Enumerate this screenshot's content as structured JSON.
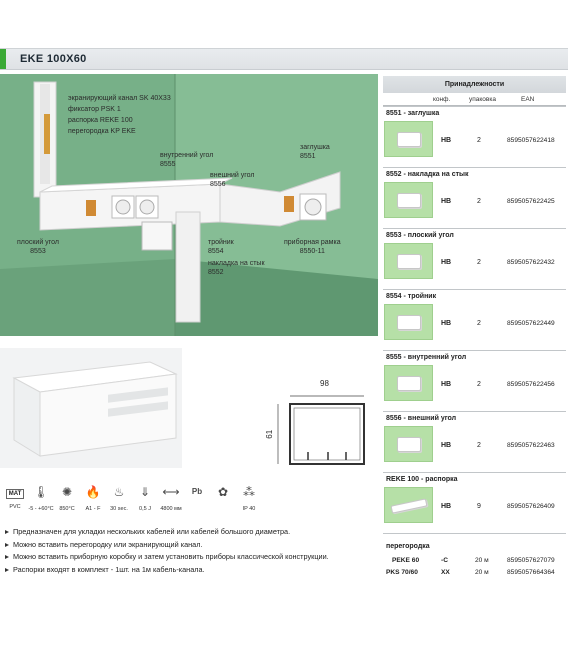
{
  "header": {
    "title": "EKE 100X60",
    "accent_color": "#3aa935"
  },
  "scene": {
    "callouts": [
      {
        "id": "screening-channel",
        "text": "экранирующий канал SK 40X33"
      },
      {
        "id": "psk",
        "text": "фиксатор PSK 1"
      },
      {
        "id": "reke",
        "text": "распорка REKE 100"
      },
      {
        "id": "kp",
        "text": "перегородка KP EKE"
      },
      {
        "id": "inner-corner",
        "text": "внутренний угол\n8555"
      },
      {
        "id": "outer-corner",
        "text": "внешний угол\n8556"
      },
      {
        "id": "end-cap",
        "text": "заглушка\n8551"
      },
      {
        "id": "flat-corner",
        "text": "плоский угол\n8553"
      },
      {
        "id": "tee",
        "text": "тройник\n8554"
      },
      {
        "id": "joint-cover",
        "text": "накладка на стык\n8552"
      },
      {
        "id": "device-frame",
        "text": "приборная рамка\n8550-11"
      }
    ]
  },
  "drawing": {
    "width_label": "98",
    "height_label": "61"
  },
  "icons": [
    {
      "name": "mat-icon",
      "glyph": "MAT",
      "caption": "PVC"
    },
    {
      "name": "thermometer-icon",
      "glyph": "🌡",
      "caption": "-5 - +60°C"
    },
    {
      "name": "glow-wire-icon",
      "glyph": "✺",
      "caption": "850°C"
    },
    {
      "name": "flame-icon",
      "glyph": "🔥",
      "caption": "A1 - F"
    },
    {
      "name": "burn-time-icon",
      "glyph": "♨",
      "caption": "30 sec."
    },
    {
      "name": "impact-icon",
      "glyph": "⇓",
      "caption": "0,5 J"
    },
    {
      "name": "length-icon",
      "glyph": "⟷",
      "caption": "4800 мм"
    },
    {
      "name": "pb-free-icon",
      "glyph": "Pb",
      "caption": ""
    },
    {
      "name": "halogen-free-icon",
      "glyph": "✿",
      "caption": ""
    },
    {
      "name": "ip-icon",
      "glyph": "⁂",
      "caption": "IP 40"
    }
  ],
  "bullets": [
    "Предназначен для укладки нескольких кабелей или кабелей большого диаметра.",
    "Можно вставить перегородку или экранирующий канал.",
    "Можно вставить приборную коробку и затем установить приборы классической конструкции.",
    "Распорки входят в комплект - 1шт. на 1м кабель-канала."
  ],
  "accessories": {
    "title": "Принадлежности",
    "columns": {
      "conf": "конф.",
      "pack": "упаковка",
      "ean": "EAN"
    },
    "items": [
      {
        "name": "8551 - заглушка",
        "conf": "HB",
        "pack": "2",
        "ean": "8595057622418"
      },
      {
        "name": "8552 - накладка на стык",
        "conf": "HB",
        "pack": "2",
        "ean": "8595057622425"
      },
      {
        "name": "8553 - плоский угол",
        "conf": "HB",
        "pack": "2",
        "ean": "8595057622432"
      },
      {
        "name": "8554 - тройник",
        "conf": "HB",
        "pack": "2",
        "ean": "8595057622449"
      },
      {
        "name": "8555 - внутренний угол",
        "conf": "HB",
        "pack": "2",
        "ean": "8595057622456"
      },
      {
        "name": "8556 - внешний угол",
        "conf": "HB",
        "pack": "2",
        "ean": "8595057622463"
      },
      {
        "name": "REKE 100 - распорка",
        "conf": "HB",
        "pack": "9",
        "ean": "8595057626409"
      }
    ],
    "partitions": {
      "title": "перегородка",
      "rows": [
        {
          "name": "PEKE 60",
          "conf": "-C",
          "pack": "20 м",
          "ean": "8595057627079"
        },
        {
          "name": "PKS 70/60",
          "conf": "XX",
          "pack": "20 м",
          "ean": "8595057664364"
        }
      ]
    },
    "thumb_color": "#b6e0a7"
  }
}
